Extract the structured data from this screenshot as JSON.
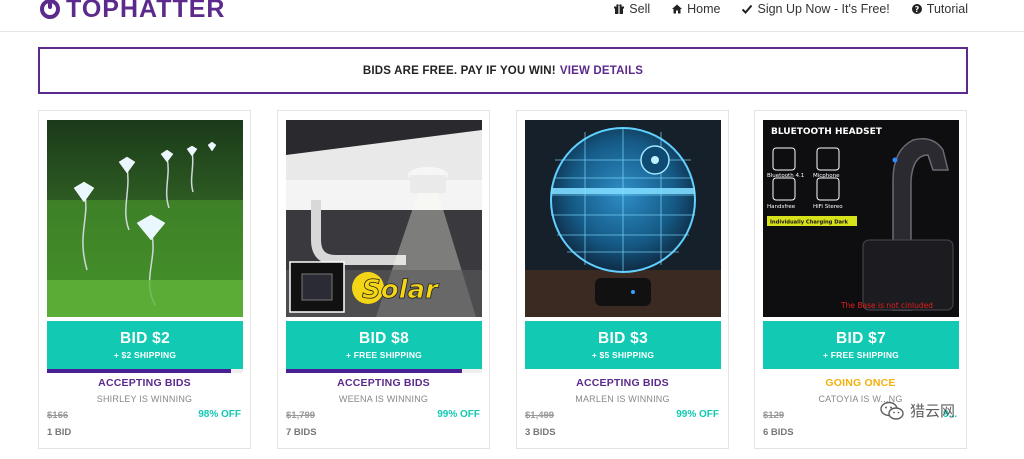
{
  "header": {
    "logo_text": "TOPHATTER",
    "nav": [
      {
        "label": "Sell",
        "icon": "gift-icon"
      },
      {
        "label": "Home",
        "icon": "home-icon"
      },
      {
        "label": "Sign Up Now - It's Free!",
        "icon": "check-icon"
      },
      {
        "label": "Tutorial",
        "icon": "question-icon"
      }
    ]
  },
  "banner": {
    "text": "BIDS ARE FREE. PAY IF YOU WIN!",
    "link": "VIEW DETAILS"
  },
  "colors": {
    "brand_purple": "#5b2a8c",
    "bid_teal": "#12c9b3",
    "going_once_yellow": "#f3b00e"
  },
  "cards": [
    {
      "image": "solar diamond garden lights",
      "bid": "BID $2",
      "shipping": "+ $2 SHIPPING",
      "progress": 0.94,
      "status": "ACCEPTING BIDS",
      "winner": "SHIRLEY IS WINNING",
      "original_price": "$166",
      "discount": "98% OFF",
      "bids": "1 BID"
    },
    {
      "image": "solar gutter light",
      "image_label": "Solar",
      "bid": "BID $8",
      "shipping": "+ FREE SHIPPING",
      "progress": 0.9,
      "status": "ACCEPTING BIDS",
      "winner": "WEENA IS WINNING",
      "original_price": "$1,799",
      "discount": "99% OFF",
      "bids": "7 BIDS"
    },
    {
      "image": "death star 3d lamp",
      "bid": "BID $3",
      "shipping": "+ $5 SHIPPING",
      "progress": 0,
      "status": "ACCEPTING BIDS",
      "winner": "MARLEN IS WINNING",
      "original_price": "$1,499",
      "discount": "99% OFF",
      "bids": "3 BIDS"
    },
    {
      "image": "bluetooth headset",
      "image_title": "BLUETOOTH HEADSET",
      "image_features": [
        "Bluetooth 4.1",
        "Micphone",
        "Handsfree",
        "HiFi Stereo"
      ],
      "image_tag": "Individually Charging Dark",
      "image_caption": "The Base is not cinluded",
      "bid": "BID $7",
      "shipping": "+ FREE SHIPPING",
      "progress": 0,
      "status": "GOING ONCE",
      "winner": "CATOYIA IS W...NG",
      "original_price": "$129",
      "discount": "9...",
      "bids": "6 BIDS"
    }
  ],
  "watermark": "猎云网"
}
